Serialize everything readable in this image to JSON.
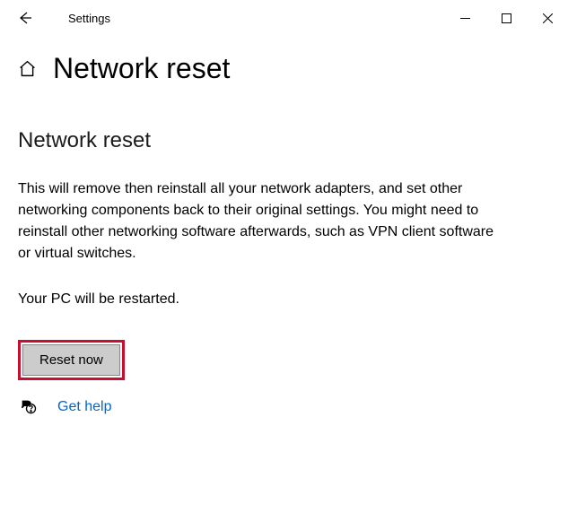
{
  "titlebar": {
    "title": "Settings"
  },
  "header": {
    "page_title": "Network reset"
  },
  "content": {
    "section_title": "Network reset",
    "description": "This will remove then reinstall all your network adapters, and set other networking components back to their original settings. You might need to reinstall other networking software afterwards, such as VPN client software or virtual switches.",
    "restart_note": "Your PC will be restarted.",
    "reset_button_label": "Reset now",
    "help_link_label": "Get help"
  }
}
